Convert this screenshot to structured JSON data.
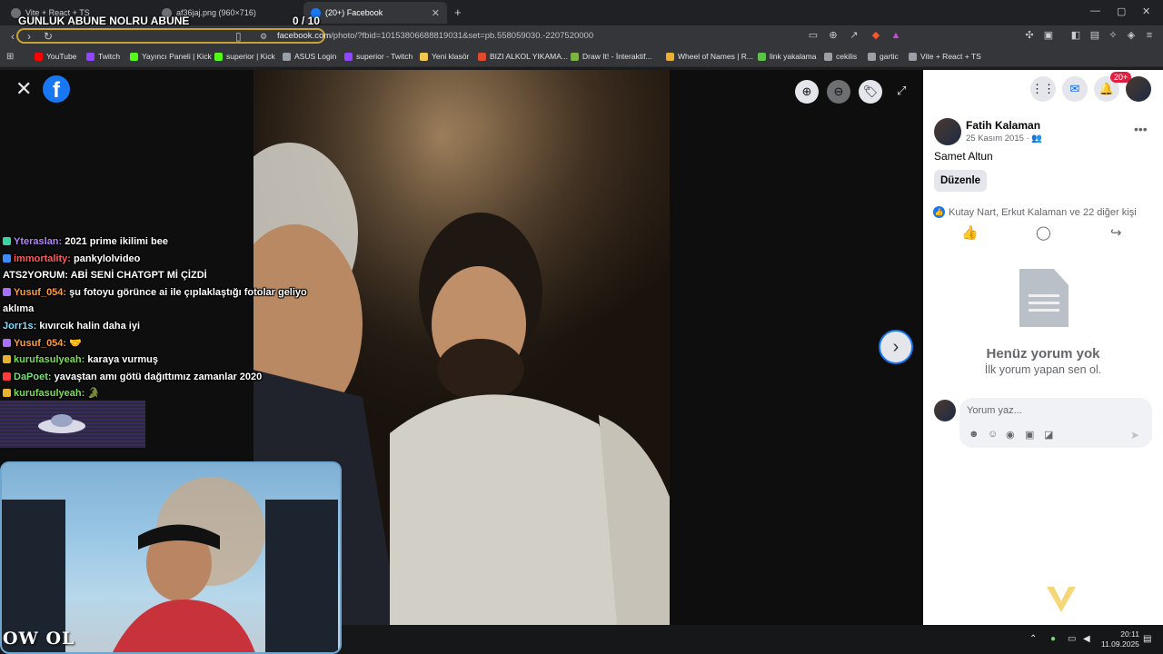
{
  "browser": {
    "tabs": [
      {
        "label": "Vite + React + TS",
        "active": false
      },
      {
        "label": "af36jaj.png (960×716)",
        "active": false
      },
      {
        "label": "(20+) Facebook",
        "active": true
      }
    ],
    "new_tab": "+",
    "window_controls": [
      "—",
      "▢",
      "✕"
    ],
    "url_host": "facebook.com",
    "url_path": "/photo/?fbid=10153806688819031&set=pb.558059030.-2207520000",
    "bookmarks": [
      {
        "label": "YouTube",
        "color": "#ff0000"
      },
      {
        "label": "Twitch",
        "color": "#9146ff"
      },
      {
        "label": "Yayıncı Paneli | Kick",
        "color": "#53fc18"
      },
      {
        "label": "superior | Kick",
        "color": "#53fc18"
      },
      {
        "label": "ASUS Login",
        "color": "#9aa0a6"
      },
      {
        "label": "superior - Twitch",
        "color": "#9146ff"
      },
      {
        "label": "Yeni klasör",
        "color": "#f2c94c"
      },
      {
        "label": "BIZI ALKOL YIKAMA...",
        "color": "#e34a2b"
      },
      {
        "label": "Draw It! - İnteraktif...",
        "color": "#7cb342"
      },
      {
        "label": "Wheel of Names | R...",
        "color": "#e8b130"
      },
      {
        "label": "link yakalama",
        "color": "#5cc24a"
      },
      {
        "label": "cekilis",
        "color": "#9aa0a6"
      },
      {
        "label": "gartic",
        "color": "#9aa0a6"
      },
      {
        "label": "Vite + React + TS",
        "color": "#9aa0a6"
      }
    ]
  },
  "viewer": {
    "fb_logo": "f",
    "close": "✕",
    "zoom_in": "⊕",
    "zoom_out": "⊖",
    "tag": "🏷",
    "fullscreen": "⤢",
    "next": "›"
  },
  "sidebar": {
    "notification_badge": "20+",
    "post": {
      "author": "Fatih Kalaman",
      "date": "25 Kasım 2015 · 👥",
      "text": "Samet Altun",
      "edit_button": "Düzenle",
      "reactions": "Kutay Nart, Erkut Kalaman ve 22 diğer kişi"
    },
    "empty_title": "Henüz yorum yok",
    "empty_subtitle": "İlk yorum yapan sen ol.",
    "comment_placeholder": "Yorum yaz..."
  },
  "overlay": {
    "goal_title": "GUNLUK ABUNE NOLRU ABUNE",
    "goal_count": "0 / 10",
    "logo": "OW OL",
    "chat": [
      {
        "user": "Yteraslan:",
        "msg": "2021 prime ikilimi bee",
        "color": "#b084f5",
        "badge": "#3ad3a3"
      },
      {
        "user": "immortality:",
        "msg": "pankylolvideo",
        "color": "#ff5a5a",
        "badge": "#3d8bff"
      },
      {
        "user": "ATS2YORUM:",
        "msg": "ABİ SENİ CHATGPT Mİ ÇİZDİ",
        "color": "#ffffff",
        "badge": ""
      },
      {
        "user": "Yusuf_054:",
        "msg": "şu fotoyu görünce ai ile çıplaklaştığı fotolar geliyo aklıma",
        "color": "#ff9b3d",
        "badge": "#a970ff"
      },
      {
        "user": "Jorr1s:",
        "msg": "kıvırcık halin daha iyi",
        "color": "#7be0ff",
        "badge": ""
      },
      {
        "user": "Yusuf_054:",
        "msg": "🤝",
        "color": "#ff9b3d",
        "badge": "#a970ff"
      },
      {
        "user": "kurufasulyeah:",
        "msg": "karaya vurmuş",
        "color": "#7ddc5a",
        "badge": "#e8b130"
      },
      {
        "user": "DaPoet:",
        "msg": "yavaştan amı götü dağıttımız zamanlar 2020",
        "color": "#74e27a",
        "badge": "#ff3b3b"
      },
      {
        "user": "kurufasulyeah:",
        "msg": "🐊",
        "color": "#7ddc5a",
        "badge": "#e8b130"
      }
    ]
  },
  "taskbar": {
    "time": "20:11",
    "date": "11.09.2025"
  }
}
